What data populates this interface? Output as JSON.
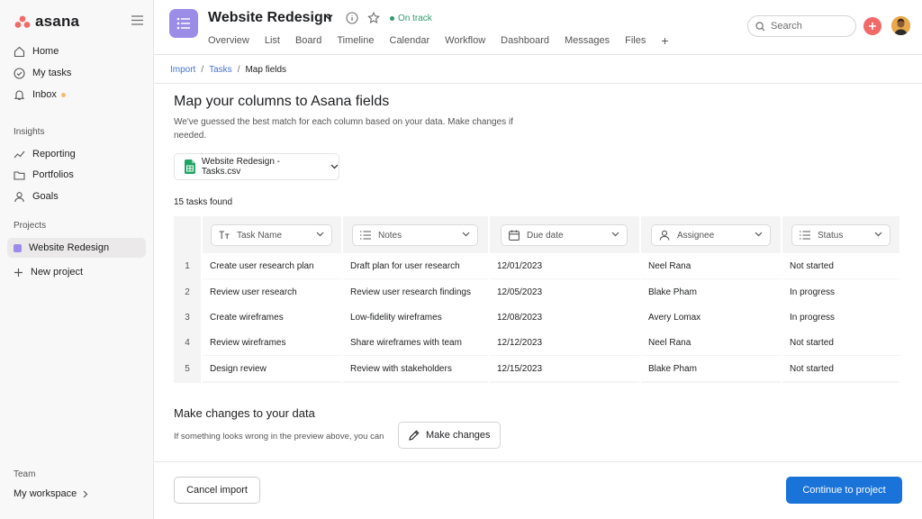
{
  "app": {
    "name": "asana"
  },
  "sidebar": {
    "nav": [
      {
        "label": "Home",
        "icon": "home-icon"
      },
      {
        "label": "My tasks",
        "icon": "check-circle-icon"
      },
      {
        "label": "Inbox",
        "icon": "bell-icon"
      }
    ],
    "insights_label": "Insights",
    "insights": [
      {
        "label": "Reporting",
        "icon": "chart-line-icon"
      },
      {
        "label": "Portfolios",
        "icon": "folder-icon"
      },
      {
        "label": "Goals",
        "icon": "person-icon"
      }
    ],
    "projects_label": "Projects",
    "projects": [
      {
        "label": "Website Redesign",
        "color": "#9b8ce8"
      }
    ],
    "new_project_label": "New project",
    "team_label": "Team",
    "workspace_label": "My workspace"
  },
  "header": {
    "project_title": "Website Redesign",
    "status": "On track",
    "tabs": [
      "Overview",
      "List",
      "Board",
      "Timeline",
      "Calendar",
      "Workflow",
      "Dashboard",
      "Messages",
      "Files"
    ],
    "search_placeholder": "Search"
  },
  "breadcrumb": [
    "Import",
    "Tasks",
    "Map fields"
  ],
  "main": {
    "title": "Map your columns to Asana fields",
    "description": "We've guessed the best match for each column based on your data. Make changes if needed.",
    "file_name": "Website Redesign - Tasks.csv",
    "tasks_found": "15 tasks found"
  },
  "table": {
    "columns": [
      {
        "label": "Task Name",
        "icon": "text-icon"
      },
      {
        "label": "Notes",
        "icon": "list-icon"
      },
      {
        "label": "Due date",
        "icon": "calendar-icon"
      },
      {
        "label": "Assignee",
        "icon": "person-icon"
      },
      {
        "label": "Status",
        "icon": "list-icon"
      }
    ],
    "rows": [
      {
        "num": "1",
        "task": "Create user research plan",
        "notes": "Draft plan for user research",
        "due": "12/01/2023",
        "assignee": "Neel Rana",
        "status": "Not started"
      },
      {
        "num": "2",
        "task": "Review user research",
        "notes": "Review user research findings",
        "due": "12/05/2023",
        "assignee": "Blake Pham",
        "status": "In progress"
      },
      {
        "num": "3",
        "task": "Create wireframes",
        "notes": "Low-fidelity wireframes",
        "due": "12/08/2023",
        "assignee": "Avery Lomax",
        "status": "In progress"
      },
      {
        "num": "4",
        "task": "Review wireframes",
        "notes": "Share wireframes with team",
        "due": "12/12/2023",
        "assignee": "Neel Rana",
        "status": "Not started"
      },
      {
        "num": "5",
        "task": "Design review",
        "notes": "Review with stakeholders",
        "due": "12/15/2023",
        "assignee": "Blake Pham",
        "status": "Not started"
      }
    ]
  },
  "changes": {
    "title": "Make changes to your data",
    "description": "If something looks wrong in the preview above, you can",
    "button_label": "Make changes"
  },
  "footer": {
    "cancel_label": "Cancel import",
    "continue_label": "Continue to project"
  },
  "colors": {
    "brand": "#f06a6a",
    "project": "#9b8ce8",
    "primary_button": "#1a73d9",
    "on_track": "#2f9a6a"
  }
}
